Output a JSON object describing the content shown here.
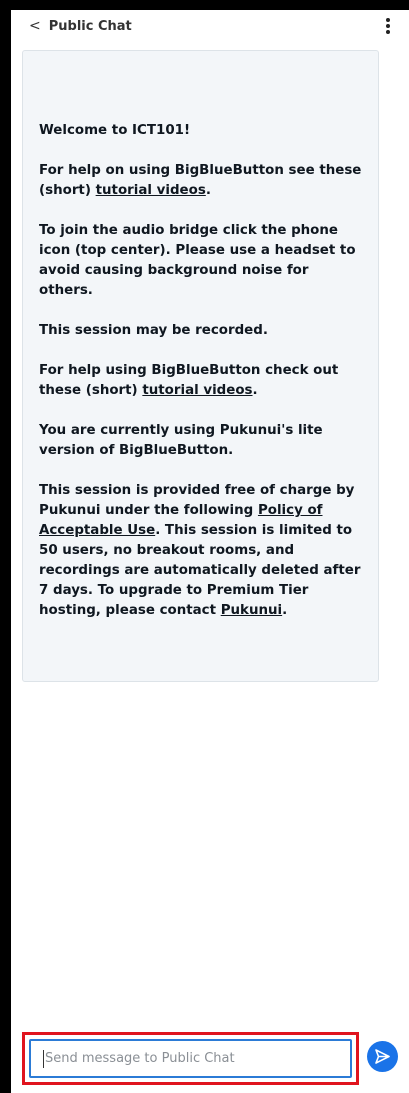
{
  "header": {
    "back_chevron": "<",
    "title": "Public Chat",
    "menu_icon": "kebab-menu-icon"
  },
  "welcome": {
    "p1": "Welcome to ICT101!",
    "p2_text": "For help on using BigBlueButton see these (short) ",
    "p2_link": "tutorial videos",
    "p2_end": ".",
    "p3": "To join the audio bridge click the phone icon (top center). Please use a headset to avoid causing background noise for others.",
    "p4": "This session may be recorded.",
    "p5_text": "For help using BigBlueButton check out these (short) ",
    "p5_link": "tutorial videos",
    "p5_end": ".",
    "p6": "You are currently using Pukunui's lite version of BigBlueButton.",
    "p7_a": "This session is provided free of charge by Pukunui under the following ",
    "p7_link1": "Policy of Acceptable Use",
    "p7_b": ". This session is limited to 50 users, no breakout rooms, and recordings are automatically deleted after 7 days. To upgrade to Premium Tier hosting, please contact ",
    "p7_link2": "Pukunui",
    "p7_end": "."
  },
  "composer": {
    "placeholder": "Send message to Public Chat",
    "send_icon": "send-arrow-icon",
    "accent": "#1a73e8",
    "highlight": "#e0141e"
  }
}
